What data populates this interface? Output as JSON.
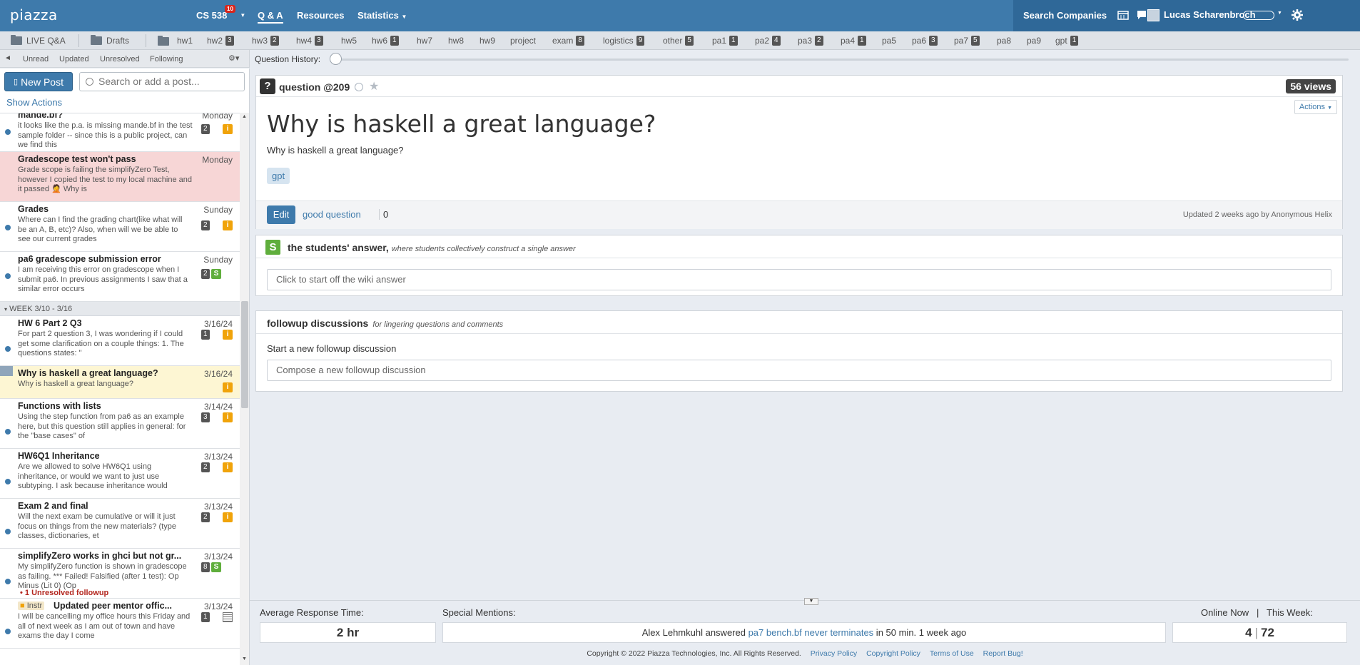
{
  "topbar": {
    "logo": "piazza",
    "course": "CS 538",
    "course_badge": "10",
    "nav": [
      "Q & A",
      "Resources",
      "Statistics"
    ],
    "search_companies": "Search Companies",
    "user": "Lucas Scharenbroch"
  },
  "folders": {
    "live_qa": "LIVE Q&A",
    "drafts": "Drafts",
    "items": [
      {
        "label": "hw1",
        "count": ""
      },
      {
        "label": "hw2",
        "count": "3"
      },
      {
        "label": "hw3",
        "count": "2"
      },
      {
        "label": "hw4",
        "count": "3"
      },
      {
        "label": "hw5",
        "count": ""
      },
      {
        "label": "hw6",
        "count": "1"
      },
      {
        "label": "hw7",
        "count": ""
      },
      {
        "label": "hw8",
        "count": ""
      },
      {
        "label": "hw9",
        "count": ""
      },
      {
        "label": "project",
        "count": ""
      },
      {
        "label": "exam",
        "count": "8"
      },
      {
        "label": "logistics",
        "count": "9"
      },
      {
        "label": "other",
        "count": "5"
      },
      {
        "label": "pa1",
        "count": "1"
      },
      {
        "label": "pa2",
        "count": "4"
      },
      {
        "label": "pa3",
        "count": "2"
      },
      {
        "label": "pa4",
        "count": "1"
      },
      {
        "label": "pa5",
        "count": ""
      },
      {
        "label": "pa6",
        "count": "3"
      },
      {
        "label": "pa7",
        "count": "5"
      },
      {
        "label": "pa8",
        "count": ""
      },
      {
        "label": "pa9",
        "count": ""
      },
      {
        "label": "gpt",
        "count": "1"
      }
    ]
  },
  "filters": {
    "collapse": "◄",
    "items": [
      "Unread",
      "Updated",
      "Unresolved",
      "Following"
    ],
    "question_history": "Question History:"
  },
  "sidebar": {
    "new_post": "New Post",
    "search_placeholder": "Search or add a post...",
    "show_actions": "Show Actions",
    "week_header": "WEEK 3/10 - 3/16",
    "posts": [
      {
        "title": "mande.bf?",
        "snippet": "it looks like the p.a. is missing mande.bf in the test sample folder -- since this is a public project, can we find this",
        "date": "Monday",
        "num": "2"
      },
      {
        "title": "Gradescope test won't pass",
        "snippet": "Grade scope is failing the simplifyZero Test, however I copied the test to my local machine and it passed 🤦 Why is",
        "date": "Monday",
        "num": ""
      },
      {
        "title": "Grades",
        "snippet": "Where can I find the grading chart(like what will be an A, B, etc)? Also, when will we be able to see our current grades",
        "date": "Sunday",
        "num": "2"
      },
      {
        "title": "pa6 gradescope submission error",
        "snippet": "I am receiving this error on gradescope when I submit pa6. In previous assignments I saw that a similar error occurs",
        "date": "Sunday",
        "num": "2"
      },
      {
        "title": "HW 6 Part 2 Q3",
        "snippet": "For part 2 question 3, I was wondering if I could get some clarification on a couple things: 1. The questions states: \"",
        "date": "3/16/24",
        "num": "1"
      },
      {
        "title": "Why is haskell a great language?",
        "snippet": "Why is haskell a great language?",
        "date": "3/16/24",
        "num": ""
      },
      {
        "title": "Functions with lists",
        "snippet": "Using the step function from pa6 as an example here, but this question still applies in general: for the \"base cases\" of",
        "date": "3/14/24",
        "num": "3"
      },
      {
        "title": "HW6Q1 Inheritance",
        "snippet": "Are we allowed to solve HW6Q1 using inheritance, or would we want to just use subtyping. I ask because inheritance would",
        "date": "3/13/24",
        "num": "2"
      },
      {
        "title": "Exam 2 and final",
        "snippet": "Will the next exam be cumulative or will it just focus on things from the new materials? (type classes, dictionaries, et",
        "date": "3/13/24",
        "num": "2"
      },
      {
        "title": "simplifyZero works in ghci but not gr...",
        "snippet": "My simplifyZero function is shown in gradescope as failing. *** Failed! Falsified (after 1 test): Op Minus (Lit 0) (Op",
        "date": "3/13/24",
        "num": "8",
        "unresolved": "1 Unresolved followup"
      },
      {
        "title": "Updated peer mentor offic...",
        "snippet": "I will be cancelling my office hours this Friday and all of next week as I am out of town and have exams the day I come",
        "date": "3/13/24",
        "num": "1",
        "instr": "Instr"
      }
    ]
  },
  "question": {
    "type_label": "question",
    "number": "@209",
    "views": "56 views",
    "actions": "Actions",
    "title": "Why is haskell a great language?",
    "body": "Why is haskell a great language?",
    "tag": "gpt",
    "edit": "Edit",
    "good_question": "good question",
    "good_count": "0",
    "updated": "Updated 2 weeks ago by Anonymous Helix"
  },
  "students_answer": {
    "icon": "S",
    "title": "the students' answer,",
    "subtitle": "where students collectively construct a single answer",
    "placeholder": "Click to start off the wiki answer"
  },
  "followups": {
    "title": "followup discussions",
    "subtitle": "for lingering questions and comments",
    "start": "Start a new followup discussion",
    "placeholder": "Compose a new followup discussion"
  },
  "stats": {
    "avg_label": "Average Response Time:",
    "avg_value": "2 hr",
    "mentions_label": "Special Mentions:",
    "mention_pre": "Alex Lehmkuhl answered ",
    "mention_link": "pa7 bench.bf never terminates",
    "mention_post": " in 50 min. 1 week ago",
    "online_label": "Online Now",
    "week_label": "This Week:",
    "online_value": "4",
    "week_value": "72"
  },
  "footer": {
    "copyright": "Copyright © 2022 Piazza Technologies, Inc. All Rights Reserved.",
    "links": [
      "Privacy Policy",
      "Copyright Policy",
      "Terms of Use",
      "Report Bug!"
    ]
  }
}
